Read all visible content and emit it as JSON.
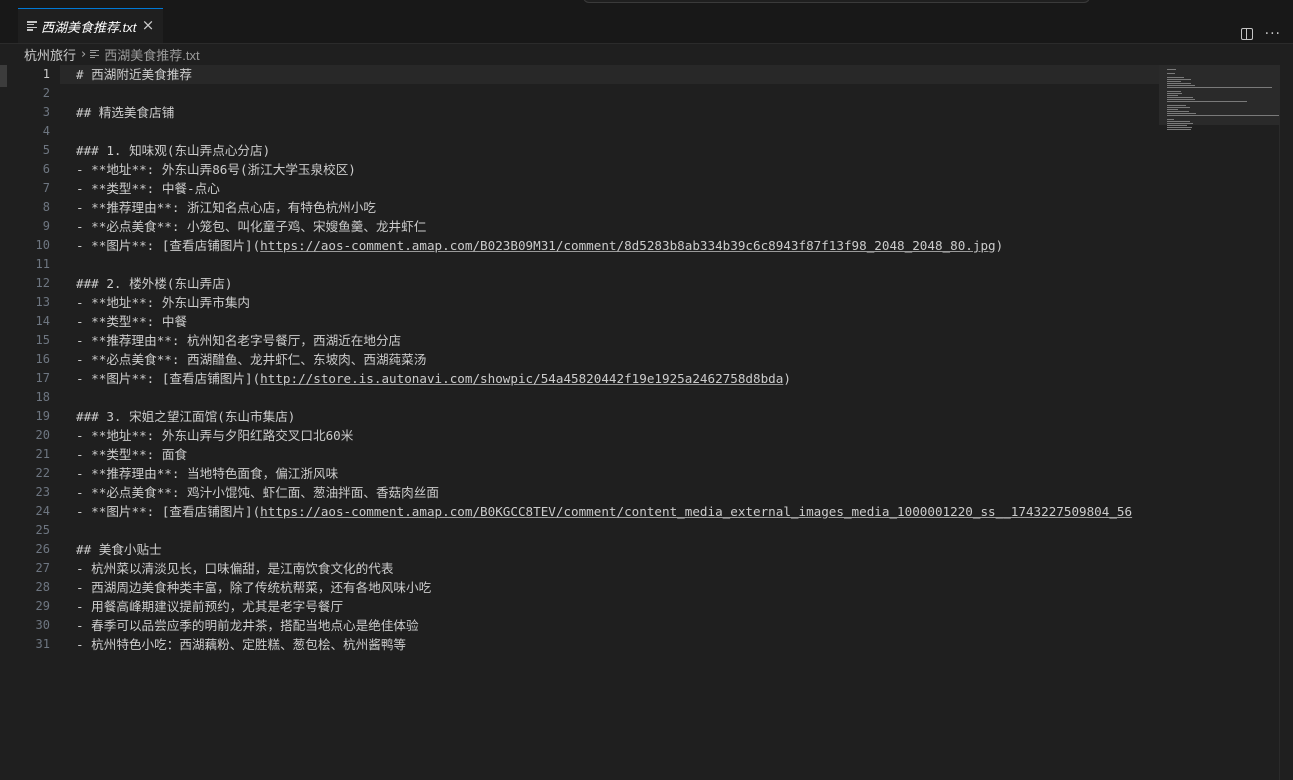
{
  "tab": {
    "title": "西湖美食推荐.txt",
    "close": "×"
  },
  "header_actions": {
    "more": "···"
  },
  "breadcrumb": {
    "folder": "杭州旅行",
    "chevron": "›",
    "file": "西湖美食推荐.txt"
  },
  "editor": {
    "active_line": 1,
    "lines": [
      "# 西湖附近美食推荐",
      "",
      "## 精选美食店铺",
      "",
      "### 1. 知味观(东山弄点心分店)",
      "- **地址**: 外东山弄86号(浙江大学玉泉校区)",
      "- **类型**: 中餐-点心",
      "- **推荐理由**: 浙江知名点心店，有特色杭州小吃",
      "- **必点美食**: 小笼包、叫化童子鸡、宋嫂鱼羹、龙井虾仁",
      "- **图片**: [查看店铺图片](https://aos-comment.amap.com/B023B09M31/comment/8d5283b8ab334b39c6c8943f87f13f98_2048_2048_80.jpg)",
      "",
      "### 2. 楼外楼(东山弄店)",
      "- **地址**: 外东山弄市集内",
      "- **类型**: 中餐",
      "- **推荐理由**: 杭州知名老字号餐厅，西湖近在地分店",
      "- **必点美食**: 西湖醋鱼、龙井虾仁、东坡肉、西湖莼菜汤",
      "- **图片**: [查看店铺图片](http://store.is.autonavi.com/showpic/54a45820442f19e1925a2462758d8bda)",
      "",
      "### 3. 宋姐之望江面馆(东山市集店)",
      "- **地址**: 外东山弄与夕阳红路交叉口北60米",
      "- **类型**: 面食",
      "- **推荐理由**: 当地特色面食，偏江浙风味",
      "- **必点美食**: 鸡汁小馄饨、虾仁面、葱油拌面、香菇肉丝面",
      "- **图片**: [查看店铺图片](https://aos-comment.amap.com/B0KGCC8TEV/comment/content_media_external_images_media_1000001220_ss__1743227509804_56",
      "",
      "## 美食小贴士",
      "- 杭州菜以清淡见长，口味偏甜，是江南饮食文化的代表",
      "- 西湖周边美食种类丰富，除了传统杭帮菜，还有各地风味小吃",
      "- 用餐高峰期建议提前预约，尤其是老字号餐厅",
      "- 春季可以品尝应季的明前龙井茶，搭配当地点心是绝佳体验",
      "- 杭州特色小吃：西湖藕粉、定胜糕、葱包桧、杭州酱鸭等"
    ]
  },
  "icons": {
    "tab_file": "text-file-icon",
    "split": "split-editor-icon",
    "more": "more-actions-icon",
    "breadcrumb_file": "text-file-icon"
  },
  "colors": {
    "accent": "#0078d4",
    "background": "#1f1f1f",
    "text": "#cccccc",
    "line_number": "#6e7681"
  }
}
